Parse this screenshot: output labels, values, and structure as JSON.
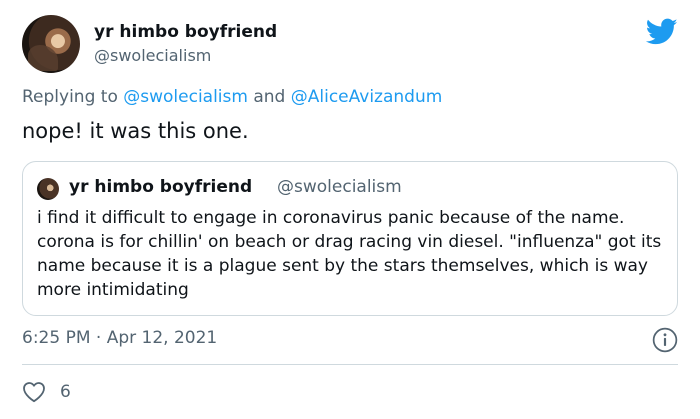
{
  "author": {
    "display_name": "yr himbo boyfriend",
    "handle": "@swolecialism"
  },
  "reply_context": {
    "prefix": "Replying to",
    "mention_1": "@swolecialism",
    "conjunction": "and",
    "mention_2": "@AliceAvizandum"
  },
  "tweet_text": "nope! it was this one.",
  "quoted_tweet": {
    "display_name": "yr himbo boyfriend",
    "handle": "@swolecialism",
    "text": "i find it difficult to engage in coronavirus panic because of the name. corona is for chillin' on beach or drag racing vin diesel. \"influenza\" got its name because it is a plague sent by the stars themselves, which is way more intimidating"
  },
  "timestamp": "6:25 PM · Apr 12, 2021",
  "likes": {
    "count": "6"
  },
  "icons": {
    "brand": "twitter-bird-icon",
    "info": "info-icon",
    "like": "heart-icon"
  },
  "colors": {
    "accent": "#1d9bf0",
    "secondary_text": "#536471",
    "border": "#cfd9de"
  }
}
